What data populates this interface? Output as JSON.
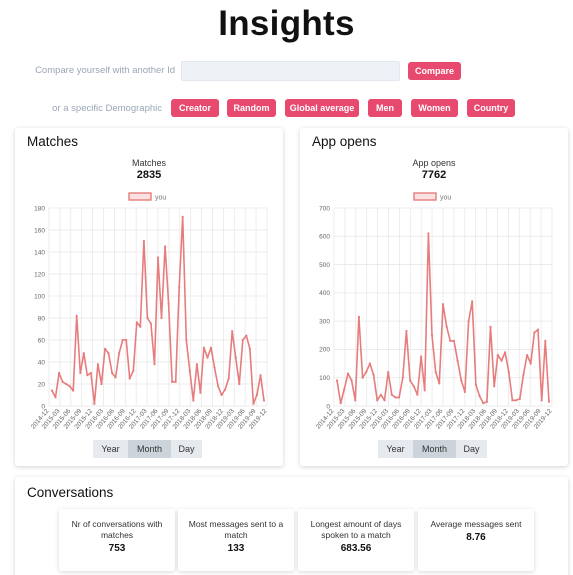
{
  "page": {
    "title": "Insights"
  },
  "compare": {
    "label": "Compare yourself with another Id",
    "input_value": "",
    "input_placeholder": "",
    "button": "Compare"
  },
  "demographic": {
    "label": "or a specific Demographic",
    "buttons": [
      "Creator",
      "Random",
      "Global average",
      "Men",
      "Women",
      "Country"
    ]
  },
  "matches": {
    "card_title": "Matches",
    "chart_label": "Matches",
    "total": "2835",
    "legend": "you",
    "periods": [
      "Year",
      "Month",
      "Day"
    ],
    "active_period": "Month"
  },
  "app_opens": {
    "card_title": "App opens",
    "chart_label": "App opens",
    "total": "7762",
    "legend": "you",
    "periods": [
      "Year",
      "Month",
      "Day"
    ],
    "active_period": "Month"
  },
  "conversations": {
    "card_title": "Conversations",
    "stats": [
      {
        "label": "Nr of conversations with matches",
        "value": "753"
      },
      {
        "label": "Most messages sent to a match",
        "value": "133"
      },
      {
        "label": "Longest amount of days spoken to a match",
        "value": "683.56"
      },
      {
        "label": "Average messages sent",
        "value": "8.76"
      }
    ]
  },
  "colors": {
    "accent": "#e84a6f",
    "line": "#e77c7c",
    "grid": "#e8e8e8",
    "tick": "#666666"
  },
  "chart_data": [
    {
      "type": "line",
      "x_tick_labels": [
        "2014-12",
        "2015-03",
        "2015-06",
        "2015-09",
        "2015-12",
        "2016-03",
        "2016-06",
        "2016-09",
        "2016-12",
        "2017-03",
        "2017-06",
        "2017-09",
        "2017-12",
        "2018-03",
        "2018-06",
        "2018-09",
        "2018-12",
        "2019-03",
        "2019-06",
        "2019-09",
        "2019-12"
      ],
      "ylim": [
        0,
        180
      ],
      "y_ticks": [
        0,
        20,
        40,
        60,
        80,
        100,
        120,
        140,
        160,
        180
      ],
      "grid": true,
      "legend_position": "top-center",
      "series": [
        {
          "name": "you",
          "values": [
            14,
            8,
            30,
            22,
            20,
            18,
            14,
            82,
            30,
            48,
            28,
            30,
            2,
            38,
            20,
            52,
            48,
            30,
            26,
            48,
            60,
            60,
            25,
            32,
            76,
            72,
            150,
            80,
            75,
            38,
            135,
            80,
            145,
            93,
            22,
            22,
            108,
            172,
            60,
            32,
            5,
            38,
            12,
            53,
            44,
            53,
            35,
            18,
            10,
            15,
            25,
            68,
            44,
            20,
            60,
            64,
            52,
            2,
            10,
            28,
            5
          ]
        }
      ]
    },
    {
      "type": "line",
      "x_tick_labels": [
        "2014-12",
        "2015-03",
        "2015-06",
        "2015-09",
        "2015-12",
        "2016-03",
        "2016-06",
        "2016-09",
        "2016-12",
        "2017-03",
        "2017-06",
        "2017-09",
        "2017-12",
        "2018-03",
        "2018-06",
        "2018-09",
        "2018-12",
        "2019-03",
        "2019-06",
        "2019-09",
        "2019-12"
      ],
      "ylim": [
        0,
        700
      ],
      "y_ticks": [
        0,
        100,
        200,
        300,
        400,
        500,
        600,
        700
      ],
      "grid": true,
      "legend_position": "top-center",
      "series": [
        {
          "name": "you",
          "values": [
            90,
            10,
            60,
            115,
            90,
            20,
            315,
            100,
            120,
            150,
            110,
            20,
            40,
            20,
            120,
            40,
            30,
            30,
            100,
            265,
            90,
            70,
            40,
            175,
            55,
            610,
            250,
            120,
            80,
            360,
            280,
            230,
            230,
            160,
            90,
            50,
            300,
            370,
            75,
            35,
            10,
            15,
            280,
            70,
            180,
            160,
            190,
            120,
            20,
            20,
            25,
            110,
            180,
            150,
            260,
            270,
            20,
            230,
            15
          ]
        }
      ]
    }
  ]
}
